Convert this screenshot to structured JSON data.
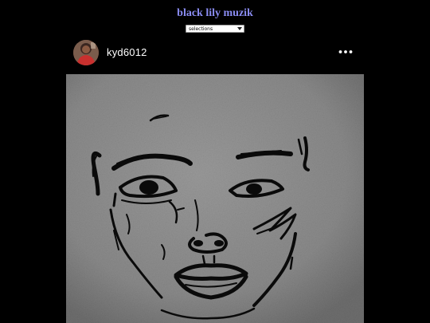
{
  "site": {
    "title": "black lily muzik"
  },
  "nav": {
    "select_value": "selections"
  },
  "post": {
    "username": "kyd6012",
    "avatar_icon": "avatar-photo",
    "menu_icon": "more-horizontal-icon",
    "image_subject": "pen sketch of a face on gray textured paper"
  },
  "colors": {
    "background": "#000000",
    "title": "#8a8cf2",
    "paper": "#8f8f8f",
    "ink": "#0a0a0a"
  }
}
